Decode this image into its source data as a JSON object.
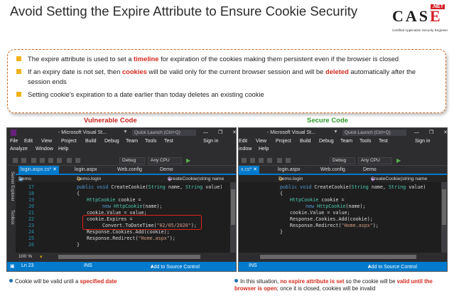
{
  "header": {
    "title": "Avoid Setting the Expire Attribute to Ensure Cookie Security",
    "logo": {
      "net": ".NET",
      "case_c": "C",
      "case_a": "A",
      "case_s": "S",
      "case_e": "E",
      "tagline": "Certified Application Security Engineer"
    }
  },
  "accent_colors": {
    "box_border": "#d26a1e",
    "bullet": "#f2b21b",
    "highlight_red": "#d42a1f",
    "secure_green": "#2f9a2c",
    "vs_blue": "#007acc"
  },
  "bullets": [
    {
      "pre": "The expire attribute is used to set a ",
      "em": "timeline",
      "post": " for expiration of the cookies making them persistent even if the browser is closed"
    },
    {
      "pre": "If an expiry date is not set, then ",
      "em": "cookies",
      "mid": " will be valid only for the current browser session and will be ",
      "em2": "deleted",
      "post": " automatically after the session ends"
    },
    {
      "text": "Setting cookie's expiration to a date earlier than today deletes an existing cookie"
    }
  ],
  "labels": {
    "vulnerable": "Vulnerable Code",
    "secure": "Secure Code"
  },
  "left_vs": {
    "window_title": "- Microsoft Visual St...",
    "quick_launch": "Quick Launch (Ctrl+Q)",
    "window_controls": "— ❐ ✕",
    "menu_row1": [
      "File",
      "Edit",
      "View",
      "Project",
      "Build",
      "Debug",
      "Team",
      "Tools",
      "Test"
    ],
    "sign_in": "Sign in",
    "menu_row2": [
      "Analyze",
      "Window",
      "Help"
    ],
    "config": "Debug",
    "platform": "Any CPU",
    "side_tabs": [
      "Server Explorer",
      "Toolbox"
    ],
    "tabs": [
      "login.aspx.cs*",
      "login.aspx",
      "Web.config",
      "Demo"
    ],
    "nav_project": "Demo",
    "nav_class": "Demo.login",
    "nav_member": "CreateCookie(string name",
    "lines": [
      17,
      18,
      19,
      20,
      21,
      22,
      23,
      24,
      25,
      26
    ],
    "zoom": "100 %",
    "status_ln": "Ln 23",
    "status_ins": "INS",
    "status_source": "Add to Source Control"
  },
  "right_vs": {
    "window_title": "- Microsoft Visual St...",
    "quick_launch": "Quick Launch (Ctrl+Q)",
    "window_controls": "— ❐ ✕",
    "menu_row1": [
      "Edit",
      "View",
      "Project",
      "Build",
      "Debug",
      "Team",
      "Tools",
      "Test"
    ],
    "sign_in": "Sign in",
    "menu_row2": [
      "indow",
      "Help"
    ],
    "config": "Debug",
    "platform": "Any CPU",
    "tabs": [
      "x.cs*",
      "login.aspx",
      "Web.config",
      "Demo"
    ],
    "nav_class": "Demo.login",
    "nav_member": "CreateCookie(string name",
    "status_ins": "INS",
    "status_source": "Add to Source Control"
  },
  "code": {
    "l17_mod": "public void ",
    "l17_fn": "CreateCookie(",
    "l17_t1": "String",
    "l17_p1": " name, ",
    "l17_t2": "String",
    "l17_p2": " value)",
    "l18": "{",
    "l19_t": "HttpCookie",
    "l19_v": " cookie =",
    "l20_kw": "new ",
    "l20_t": "HttpCookie",
    "l20_a": "(name);",
    "l21": "cookie.Value = value;",
    "l22": "cookie.Expires =",
    "l23_a": "Convert.ToDateTime(",
    "l23_s": "\"02/05/2020\"",
    "l23_b": ");",
    "l24": "Response.Cookies.Add(cookie);",
    "l25_a": "Response.Redirect(",
    "l25_s": "\"Home.aspx\"",
    "l25_b": ");",
    "l26": "}"
  },
  "notes": {
    "left_pre": "Cookie will be valid until a ",
    "left_em": "specified date",
    "right_pre": "In this situation, ",
    "right_em1": "no expire attribute is set",
    "right_mid": " so the cookie will be ",
    "right_em2": "valid until the browser is open",
    "right_post": "; once it is closed, cookies will be invalid"
  }
}
